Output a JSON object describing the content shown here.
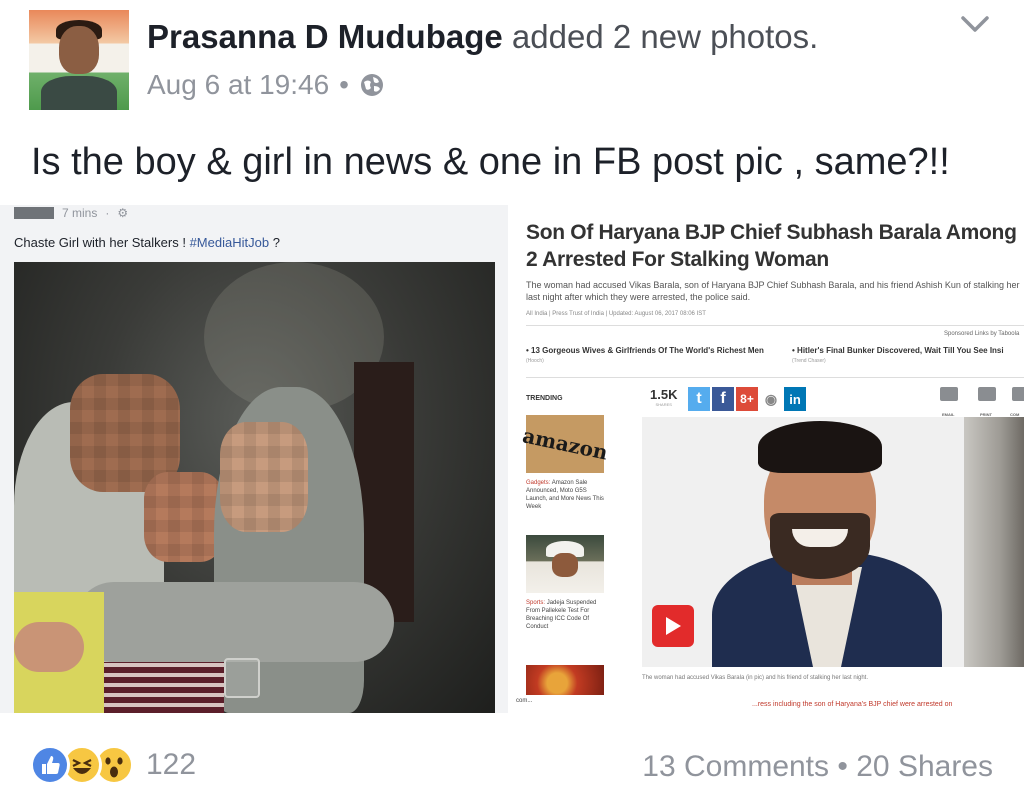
{
  "post": {
    "author_name": "Prasanna D Mudubage",
    "action": "added 2 new photos.",
    "timestamp": "Aug 6 at 19:46",
    "separator": "•",
    "privacy_icon": "globe-icon",
    "menu_icon": "chevron-down-icon",
    "text": "Is the boy & girl in news & one in FB post pic , same?!!"
  },
  "photo_left": {
    "time": "7 mins",
    "gear_glyph": "⚙",
    "separator": "·",
    "caption_prefix": "Chaste Girl with her Stalkers !",
    "caption_tag": "#MediaHitJob",
    "caption_suffix": "?"
  },
  "photo_right": {
    "headline": "Son Of Haryana BJP Chief Subhash Barala Among 2 Arrested For Stalking Woman",
    "summary": "The woman had accused Vikas Barala, son of Haryana BJP Chief Subhash Barala, and his friend Ashish Kun of stalking her last night after which they were arrested, the police said.",
    "byline": "All India | Press Trust of India | Updated: August 06, 2017 08:06 IST",
    "sponsored": "Sponsored Links by Taboola",
    "sponsored_items": [
      {
        "bullet": "•",
        "title": "13 Gorgeous Wives & Girlfriends Of The World's Richest Men",
        "source": "(Hooch)"
      },
      {
        "bullet": "•",
        "title": "Hitler's Final Bunker Discovered, Wait Till You See Insi",
        "source": "(Trend Chaser)"
      }
    ],
    "trending_label": "TRENDING",
    "trending": [
      {
        "image_text": "amazon",
        "category": "Gadgets:",
        "text": "Amazon Sale Announced, Moto G5S Launch, and More News This Week"
      },
      {
        "category": "Sports:",
        "text": "Jadeja Suspended From Pallekele Test For Breaching ICC Code Of Conduct"
      }
    ],
    "share_count": "1.5K",
    "share_count_label": "SHARES",
    "share_buttons": [
      {
        "icon": "twitter-icon",
        "glyph": "t",
        "color": "#55acee"
      },
      {
        "icon": "facebook-icon",
        "glyph": "f",
        "color": "#3b5998"
      },
      {
        "icon": "google-plus-icon",
        "glyph": "8+",
        "color": "#dd4b39"
      },
      {
        "icon": "reddit-icon",
        "glyph": "◉",
        "color": "#ffffff"
      },
      {
        "icon": "linkedin-icon",
        "glyph": "in",
        "color": "#0077b5"
      }
    ],
    "tools": [
      {
        "icon": "email-icon",
        "label": "EMAIL"
      },
      {
        "icon": "print-icon",
        "label": "PRINT"
      },
      {
        "icon": "comment-icon",
        "label": "COM"
      }
    ],
    "photo_caption": "The woman had accused Vikas Barala (in pic) and his friend of stalking her last night.",
    "dotcom": "com...",
    "ticker": "...ress including the son of Haryana's BJP chief were arrested on"
  },
  "footer": {
    "reactions": [
      "like-icon",
      "haha-icon",
      "wow-icon"
    ],
    "reaction_count": "122",
    "comments": "13 Comments",
    "separator": "•",
    "shares": "20 Shares"
  },
  "colors": {
    "text": "#1d2129",
    "secondary": "#90949c",
    "link": "#365899",
    "like": "#4f86e4",
    "emoji": "#f7c742"
  }
}
